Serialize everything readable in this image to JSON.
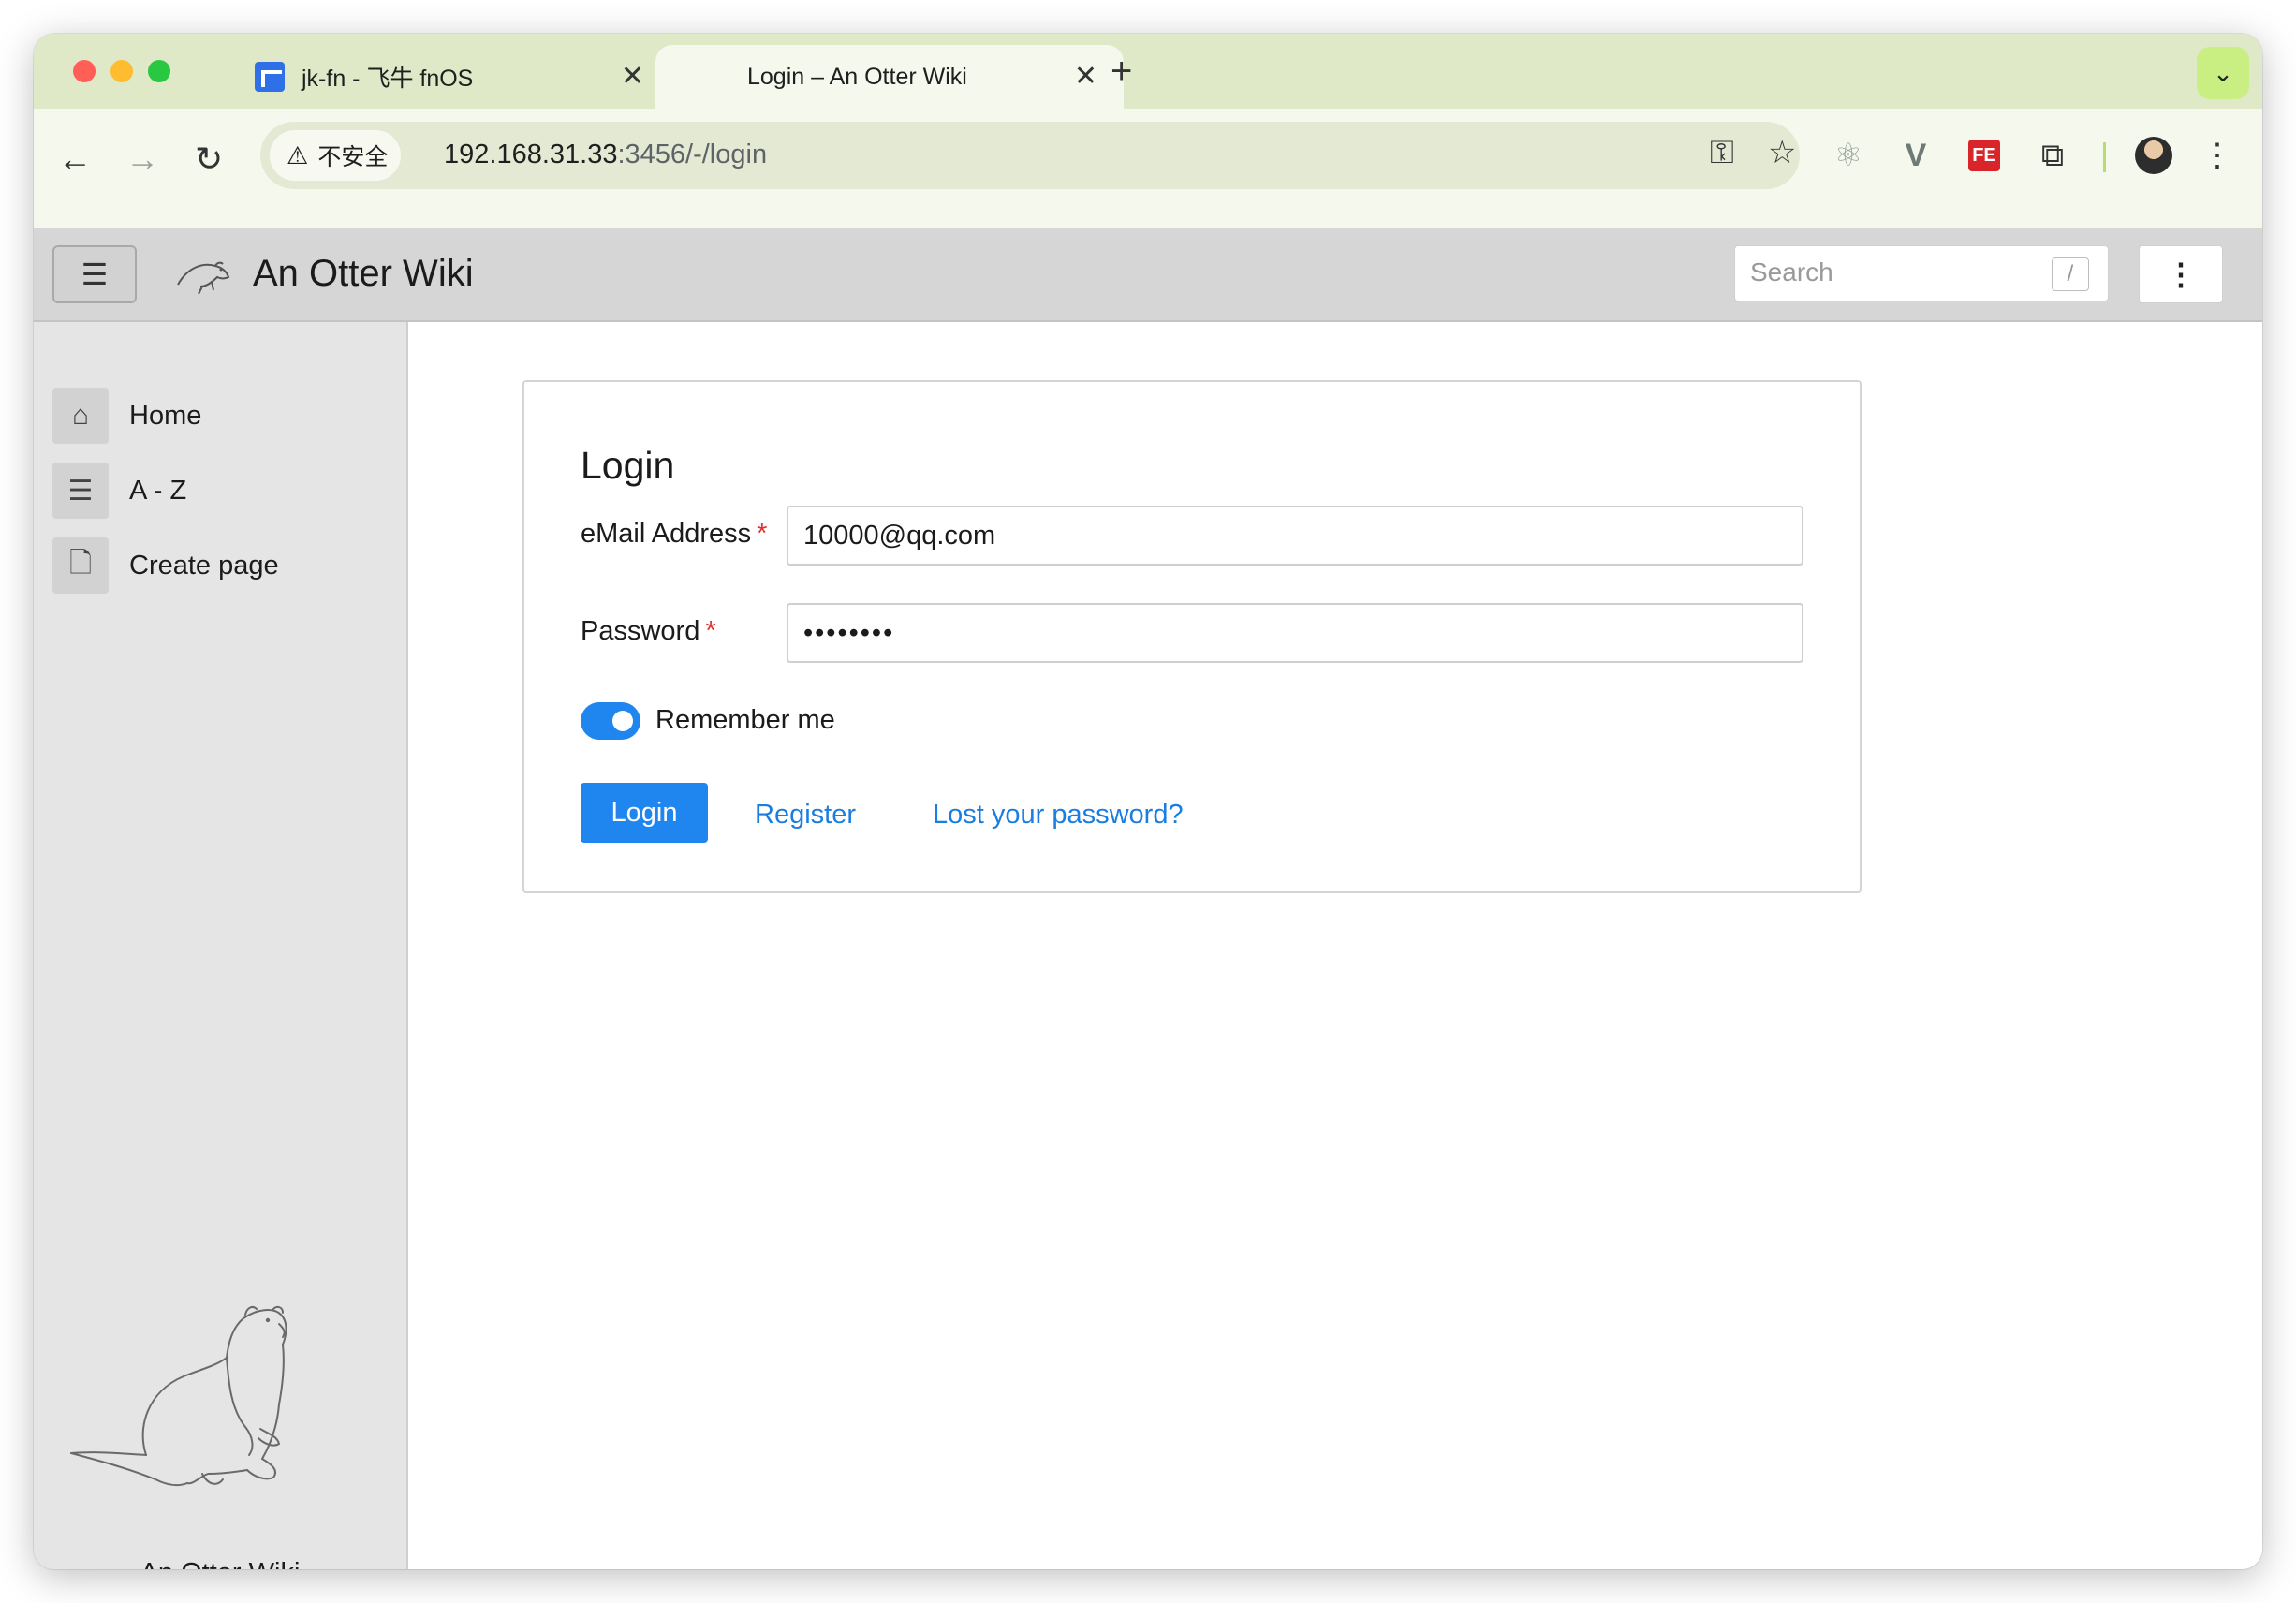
{
  "browser": {
    "tabs": [
      {
        "title": "jk-fn - 飞牛 fnOS",
        "close": "✕"
      },
      {
        "title": "Login – An Otter Wiki",
        "close": "✕"
      }
    ],
    "new_tab": "+",
    "security_label": "不安全",
    "url_host": "192.168.31.33",
    "url_rest": ":3456/-/login"
  },
  "app": {
    "title": "An Otter Wiki",
    "search_placeholder": "Search",
    "search_shortcut": "/"
  },
  "sidebar": {
    "items": [
      {
        "label": "Home",
        "icon": "home-icon"
      },
      {
        "label": "A - Z",
        "icon": "list-icon"
      },
      {
        "label": "Create page",
        "icon": "file-icon"
      }
    ],
    "footer": "An Otter Wiki"
  },
  "login": {
    "heading": "Login",
    "email_label": "eMail Address",
    "email_value": "10000@qq.com",
    "password_label": "Password",
    "password_value": "••••••••",
    "required_mark": "*",
    "remember_label": "Remember me",
    "remember_checked": true,
    "login_button": "Login",
    "register_link": "Register",
    "lost_password_link": "Lost your password?"
  },
  "colors": {
    "accent": "#1f86f0",
    "link": "#1a7ee0",
    "required": "#e03131",
    "tabstrip": "#dfe9c8",
    "toolbar": "#f5f8ec"
  }
}
